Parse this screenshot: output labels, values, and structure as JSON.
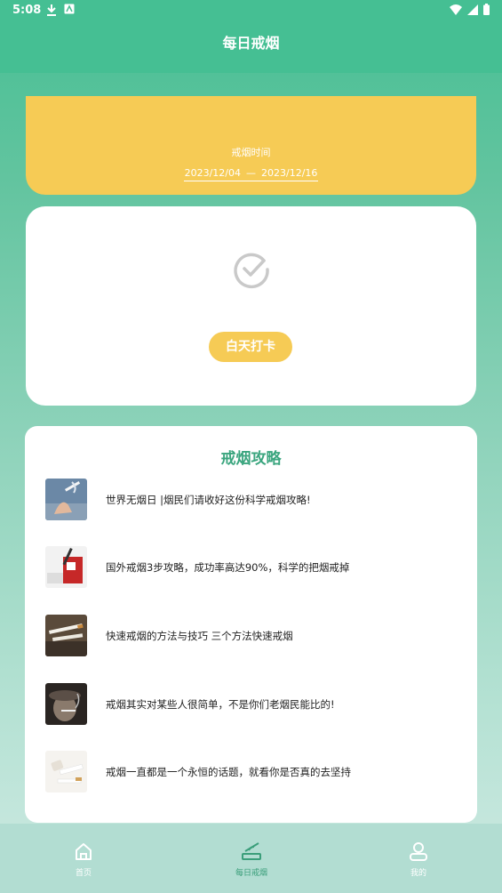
{
  "status": {
    "time": "5:08"
  },
  "appbar": {
    "title": "每日戒烟"
  },
  "quit_period": {
    "label": "戒烟时间",
    "start": "2023/12/04",
    "separator": "—",
    "end": "2023/12/16"
  },
  "checkin": {
    "button_label": "白天打卡"
  },
  "guide": {
    "title": "戒烟攻略",
    "items": [
      {
        "title": "世界无烟日 |烟民们请收好这份科学戒烟攻略!"
      },
      {
        "title": "国外戒烟3步攻略，成功率高达90%，科学的把烟戒掉"
      },
      {
        "title": "快速戒烟的方法与技巧 三个方法快速戒烟"
      },
      {
        "title": "戒烟其实对某些人很简单，不是你们老烟民能比的!"
      },
      {
        "title": "戒烟一直都是一个永恒的话题，就看你是否真的去坚持"
      }
    ]
  },
  "nav": {
    "items": [
      {
        "label": "首页",
        "icon": "home-icon"
      },
      {
        "label": "每日戒烟",
        "icon": "no-smoking-icon"
      },
      {
        "label": "我的",
        "icon": "user-icon"
      }
    ],
    "active_color": "#3a9e7a"
  },
  "colors": {
    "accent": "#45bf93",
    "yellow": "#f6cb55",
    "title_green": "#3aa57e"
  }
}
